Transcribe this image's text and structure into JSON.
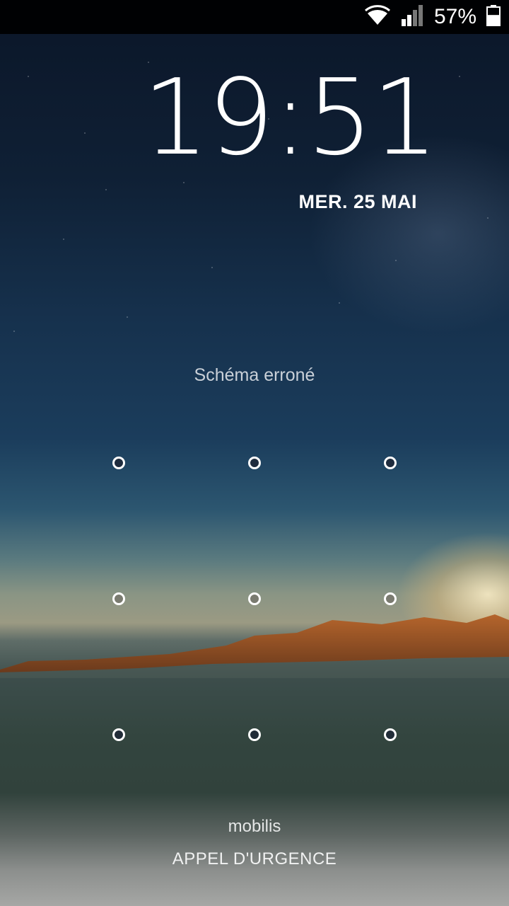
{
  "status_bar": {
    "battery_percent": "57%",
    "battery_level": 0.57,
    "icons": [
      "wifi-icon",
      "signal-icon",
      "battery-icon"
    ]
  },
  "lockscreen": {
    "time": "19:51",
    "date": "MER. 25 MAI",
    "message": "Schéma erroné",
    "carrier": "mobilis",
    "emergency_label": "APPEL D'URGENCE"
  },
  "pattern_grid": {
    "rows": 3,
    "columns": 3
  },
  "colors": {
    "statusbar_bg": "#000000",
    "text_primary": "#ffffff",
    "message_text": "#c9d0d8"
  }
}
